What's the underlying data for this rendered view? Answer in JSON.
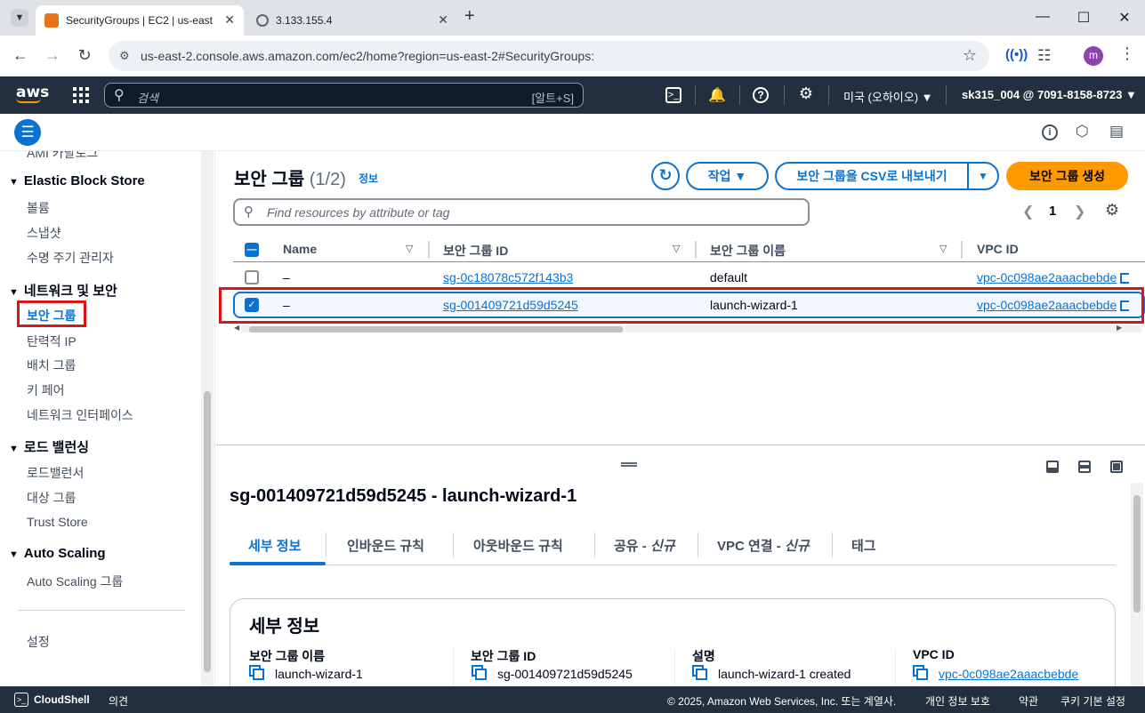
{
  "browser": {
    "tabs": [
      {
        "title": "SecurityGroups | EC2 | us-east",
        "active": true,
        "favicon_color": "#e8731a"
      },
      {
        "title": "3.133.155.4",
        "active": false
      }
    ],
    "new_tab_label": "+",
    "url": "us-east-2.console.aws.amazon.com/ec2/home?region=us-east-2#SecurityGroups:",
    "profile_initial": "m"
  },
  "aws_nav": {
    "logo": "aws",
    "search_placeholder": "검색",
    "search_shortcut": "[알트+S]",
    "region": "미국 (오하이오) ▼",
    "account": "sk315_004 @ 7091-8158-8723 ▼"
  },
  "sidebar": {
    "cut_item": "AMI 카탈로그",
    "sections": [
      {
        "title": "Elastic Block Store",
        "items": [
          "볼륨",
          "스냅샷",
          "수명 주기 관리자"
        ]
      },
      {
        "title": "네트워크 및 보안",
        "items": [
          "보안 그룹",
          "탄력적 IP",
          "배치 그룹",
          "키 페어",
          "네트워크 인터페이스"
        ]
      },
      {
        "title": "로드 밸런싱",
        "items": [
          "로드밸런서",
          "대상 그룹",
          "Trust Store"
        ]
      },
      {
        "title": "Auto Scaling",
        "items": [
          "Auto Scaling 그룹"
        ]
      }
    ],
    "settings": "설정"
  },
  "main": {
    "title": "보안 그룹",
    "count": "(1/2)",
    "info": "정보",
    "actions_button": "작업 ▼",
    "export_button": "보안 그룹을 CSV로 내보내기",
    "export_dropdown": "▼",
    "create_button": "보안 그룹 생성",
    "filter_placeholder": "Find resources by attribute or tag",
    "page": "1",
    "columns": [
      "Name",
      "보안 그룹 ID",
      "보안 그룹 이름",
      "VPC ID"
    ],
    "rows": [
      {
        "name": "–",
        "id": "sg-0c18078c572f143b3",
        "group_name": "default",
        "vpc": "vpc-0c098ae2aaacbebde",
        "selected": false
      },
      {
        "name": "–",
        "id": "sg-001409721d59d5245",
        "group_name": "launch-wizard-1",
        "vpc": "vpc-0c098ae2aaacbebde",
        "selected": true
      }
    ]
  },
  "detail": {
    "title": "sg-001409721d59d5245 - launch-wizard-1",
    "tabs": [
      "세부 정보",
      "인바운드 규칙",
      "아웃바운드 규칙",
      "공유 - ",
      "신규",
      "VPC 연결 - ",
      "신규",
      "태그"
    ],
    "card_title": "세부 정보",
    "fields": [
      {
        "label": "보안 그룹 이름",
        "value": "launch-wizard-1"
      },
      {
        "label": "보안 그룹 ID",
        "value": "sg-001409721d59d5245"
      },
      {
        "label": "설명",
        "value": "launch-wizard-1 created"
      },
      {
        "label": "VPC ID",
        "value": "vpc-0c098ae2aaacbebde"
      }
    ]
  },
  "footer": {
    "cloudshell": "CloudShell",
    "feedback": "의견",
    "copyright": "© 2025, Amazon Web Services, Inc. 또는 계열사.",
    "privacy": "개인 정보 보호",
    "terms": "약관",
    "cookies": "쿠키 기본 설정"
  }
}
